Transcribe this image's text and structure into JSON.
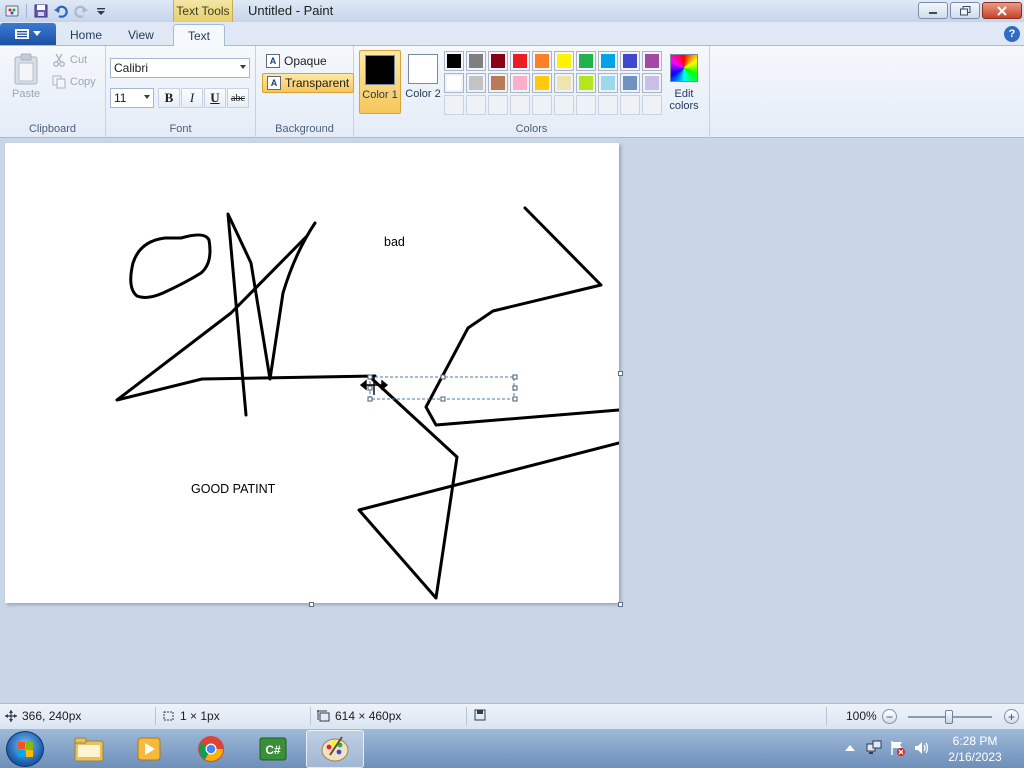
{
  "window": {
    "title": "Untitled - Paint",
    "context_tab_header": "Text Tools"
  },
  "tabs": [
    "Home",
    "View",
    "Text"
  ],
  "ribbon": {
    "clipboard": {
      "label": "Clipboard",
      "paste": "Paste",
      "cut": "Cut",
      "copy": "Copy"
    },
    "font": {
      "label": "Font",
      "family": "Calibri",
      "size": "11",
      "bold": "B",
      "italic": "I",
      "underline": "U",
      "strikethrough": "abc"
    },
    "background": {
      "label": "Background",
      "opaque": "Opaque",
      "transparent": "Transparent"
    },
    "colors": {
      "label": "Colors",
      "color1": "Color 1",
      "color2": "Color 2",
      "edit_colors": "Edit colors",
      "color1_value": "#000000",
      "color2_value": "#ffffff",
      "palette_row1": [
        "#000000",
        "#7f7f7f",
        "#880015",
        "#ed1c24",
        "#ff7f27",
        "#fff200",
        "#22b14c",
        "#00a2e8",
        "#3f48cc",
        "#a349a4"
      ],
      "palette_row2": [
        "#ffffff",
        "#c3c3c3",
        "#b97a57",
        "#ffaec9",
        "#ffc90e",
        "#efe4b0",
        "#b5e61d",
        "#99d9ea",
        "#7092be",
        "#c8bfe7"
      ]
    }
  },
  "canvas": {
    "texts": [
      "bad",
      "GOOD PATINT"
    ]
  },
  "statusbar": {
    "cursor_pos": "366, 240px",
    "selection_size": "1 × 1px",
    "image_size": "614 × 460px",
    "zoom": "100%",
    "zoom_level_percent": 100
  },
  "taskbar": {
    "time": "6:28 PM",
    "date": "2/16/2023"
  }
}
